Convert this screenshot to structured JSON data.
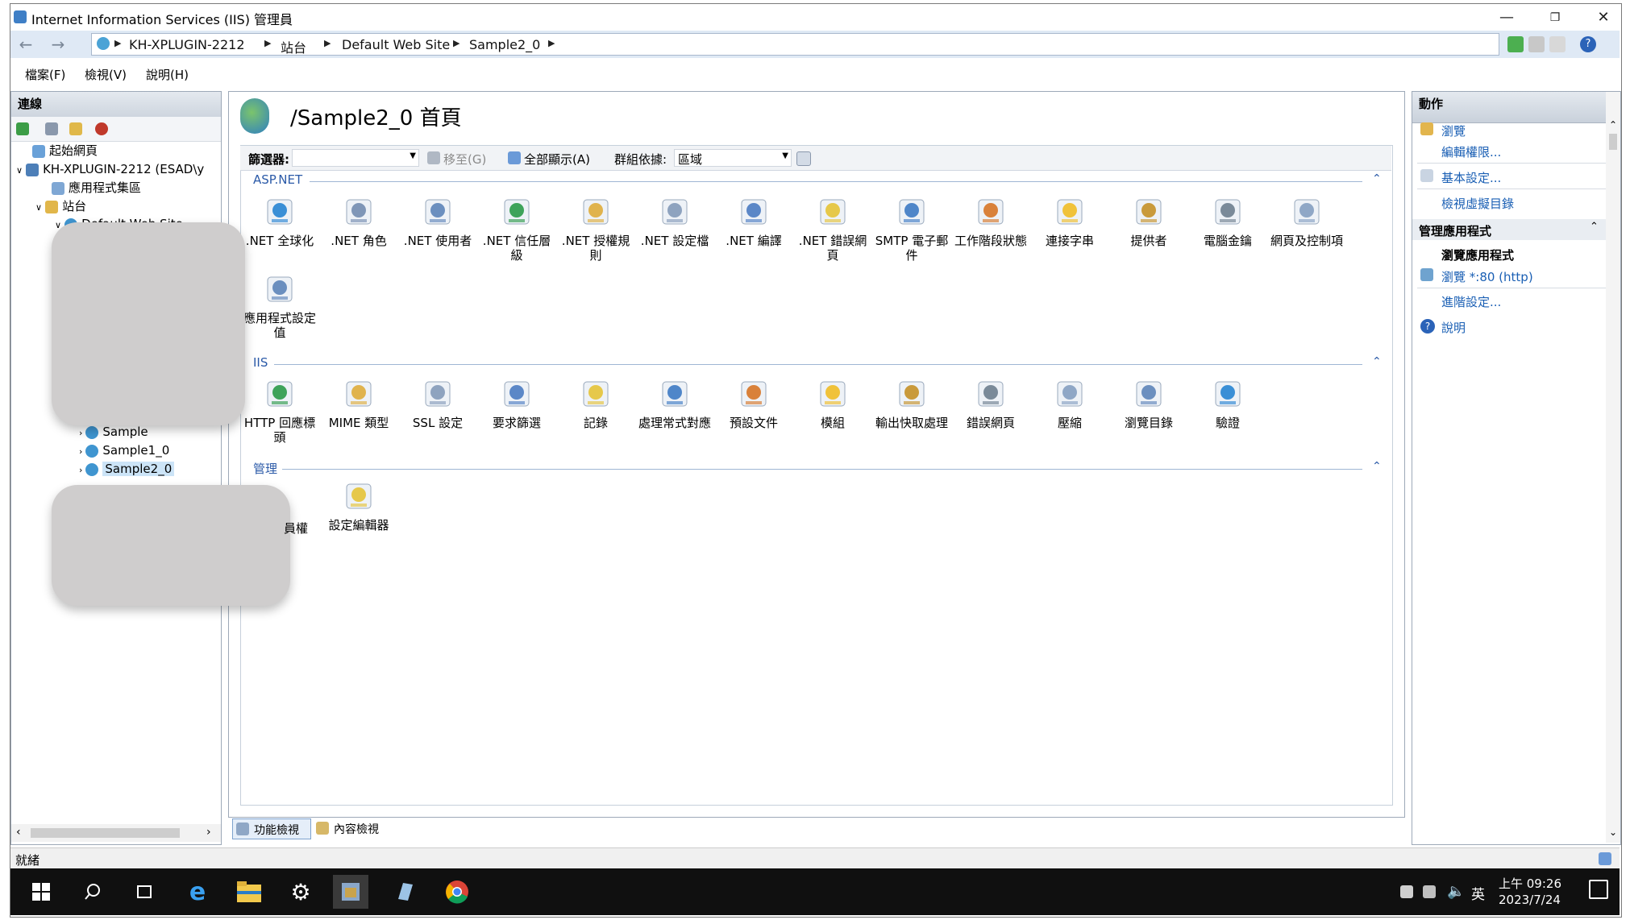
{
  "window": {
    "title": "Internet Information Services (IIS) 管理員",
    "controls": [
      "minimize-icon",
      "restore-icon",
      "close-icon"
    ]
  },
  "address": {
    "crumbs": [
      "KH-XPLUGIN-2212",
      "站台",
      "Default Web Site",
      "Sample2_0"
    ]
  },
  "menu": [
    "檔案(F)",
    "檢視(V)",
    "說明(H)"
  ],
  "connections": {
    "header": "連線",
    "tree": [
      {
        "label": "起始網頁"
      },
      {
        "label": "KH-XPLUGIN-2212 (ESAD\\y"
      },
      {
        "label": "應用程式集區"
      },
      {
        "label": "站台"
      },
      {
        "label": "Default Web Site"
      },
      {
        "label": "Sample"
      },
      {
        "label": "Sample1_0"
      },
      {
        "label": "Sample2_0"
      }
    ]
  },
  "center": {
    "title": "/Sample2_0 首頁",
    "toolbar": {
      "filter_label": "篩選器:",
      "goto_label": "移至(G)",
      "showall_label": "全部顯示(A)",
      "groupby_label": "群組依據:",
      "groupby_value": "區域"
    },
    "groups": [
      {
        "name": "ASP.NET",
        "items": [
          ".NET 全球化",
          ".NET 角色",
          ".NET 使用者",
          ".NET 信任層級",
          ".NET 授權規則",
          ".NET 設定檔",
          ".NET 編譯",
          ".NET 錯誤網頁",
          "SMTP 電子郵件",
          "工作階段狀態",
          "連接字串",
          "提供者",
          "電腦金鑰",
          "網頁及控制項",
          "應用程式設定值"
        ]
      },
      {
        "name": "IIS",
        "items": [
          "HTTP 回應標頭",
          "MIME 類型",
          "SSL 設定",
          "要求篩選",
          "記錄",
          "處理常式對應",
          "預設文件",
          "模組",
          "輸出快取處理",
          "錯誤網頁",
          "壓縮",
          "瀏覽目錄",
          "驗證"
        ]
      },
      {
        "name": "管理",
        "items": [
          "IIS 管理員權限",
          "設定編輯器"
        ]
      }
    ],
    "visible_partial_item": "員權",
    "views": [
      "功能檢視",
      "內容檢視"
    ]
  },
  "actions": {
    "header": "動作",
    "items": [
      "瀏覽",
      "編輯權限...",
      "基本設定...",
      "檢視虛擬目錄"
    ],
    "section": "管理應用程式",
    "sub_header": "瀏覽應用程式",
    "browse": "瀏覽 *:80 (http)",
    "advanced": "進階設定...",
    "help": "說明"
  },
  "status": {
    "text": "就緒"
  },
  "taskbar": {
    "ime": "英",
    "time": "上午 09:26",
    "date": "2023/7/24",
    "apps": [
      "start-icon",
      "search-icon",
      "task-view-icon",
      "edge-icon",
      "file-explorer-icon",
      "settings-icon",
      "iis-manager-icon",
      "app-icon",
      "chrome-icon"
    ]
  },
  "colors": {
    "link": "#1a5fb4",
    "group": "#2b5aa8",
    "accent": "#dfe9f5"
  }
}
